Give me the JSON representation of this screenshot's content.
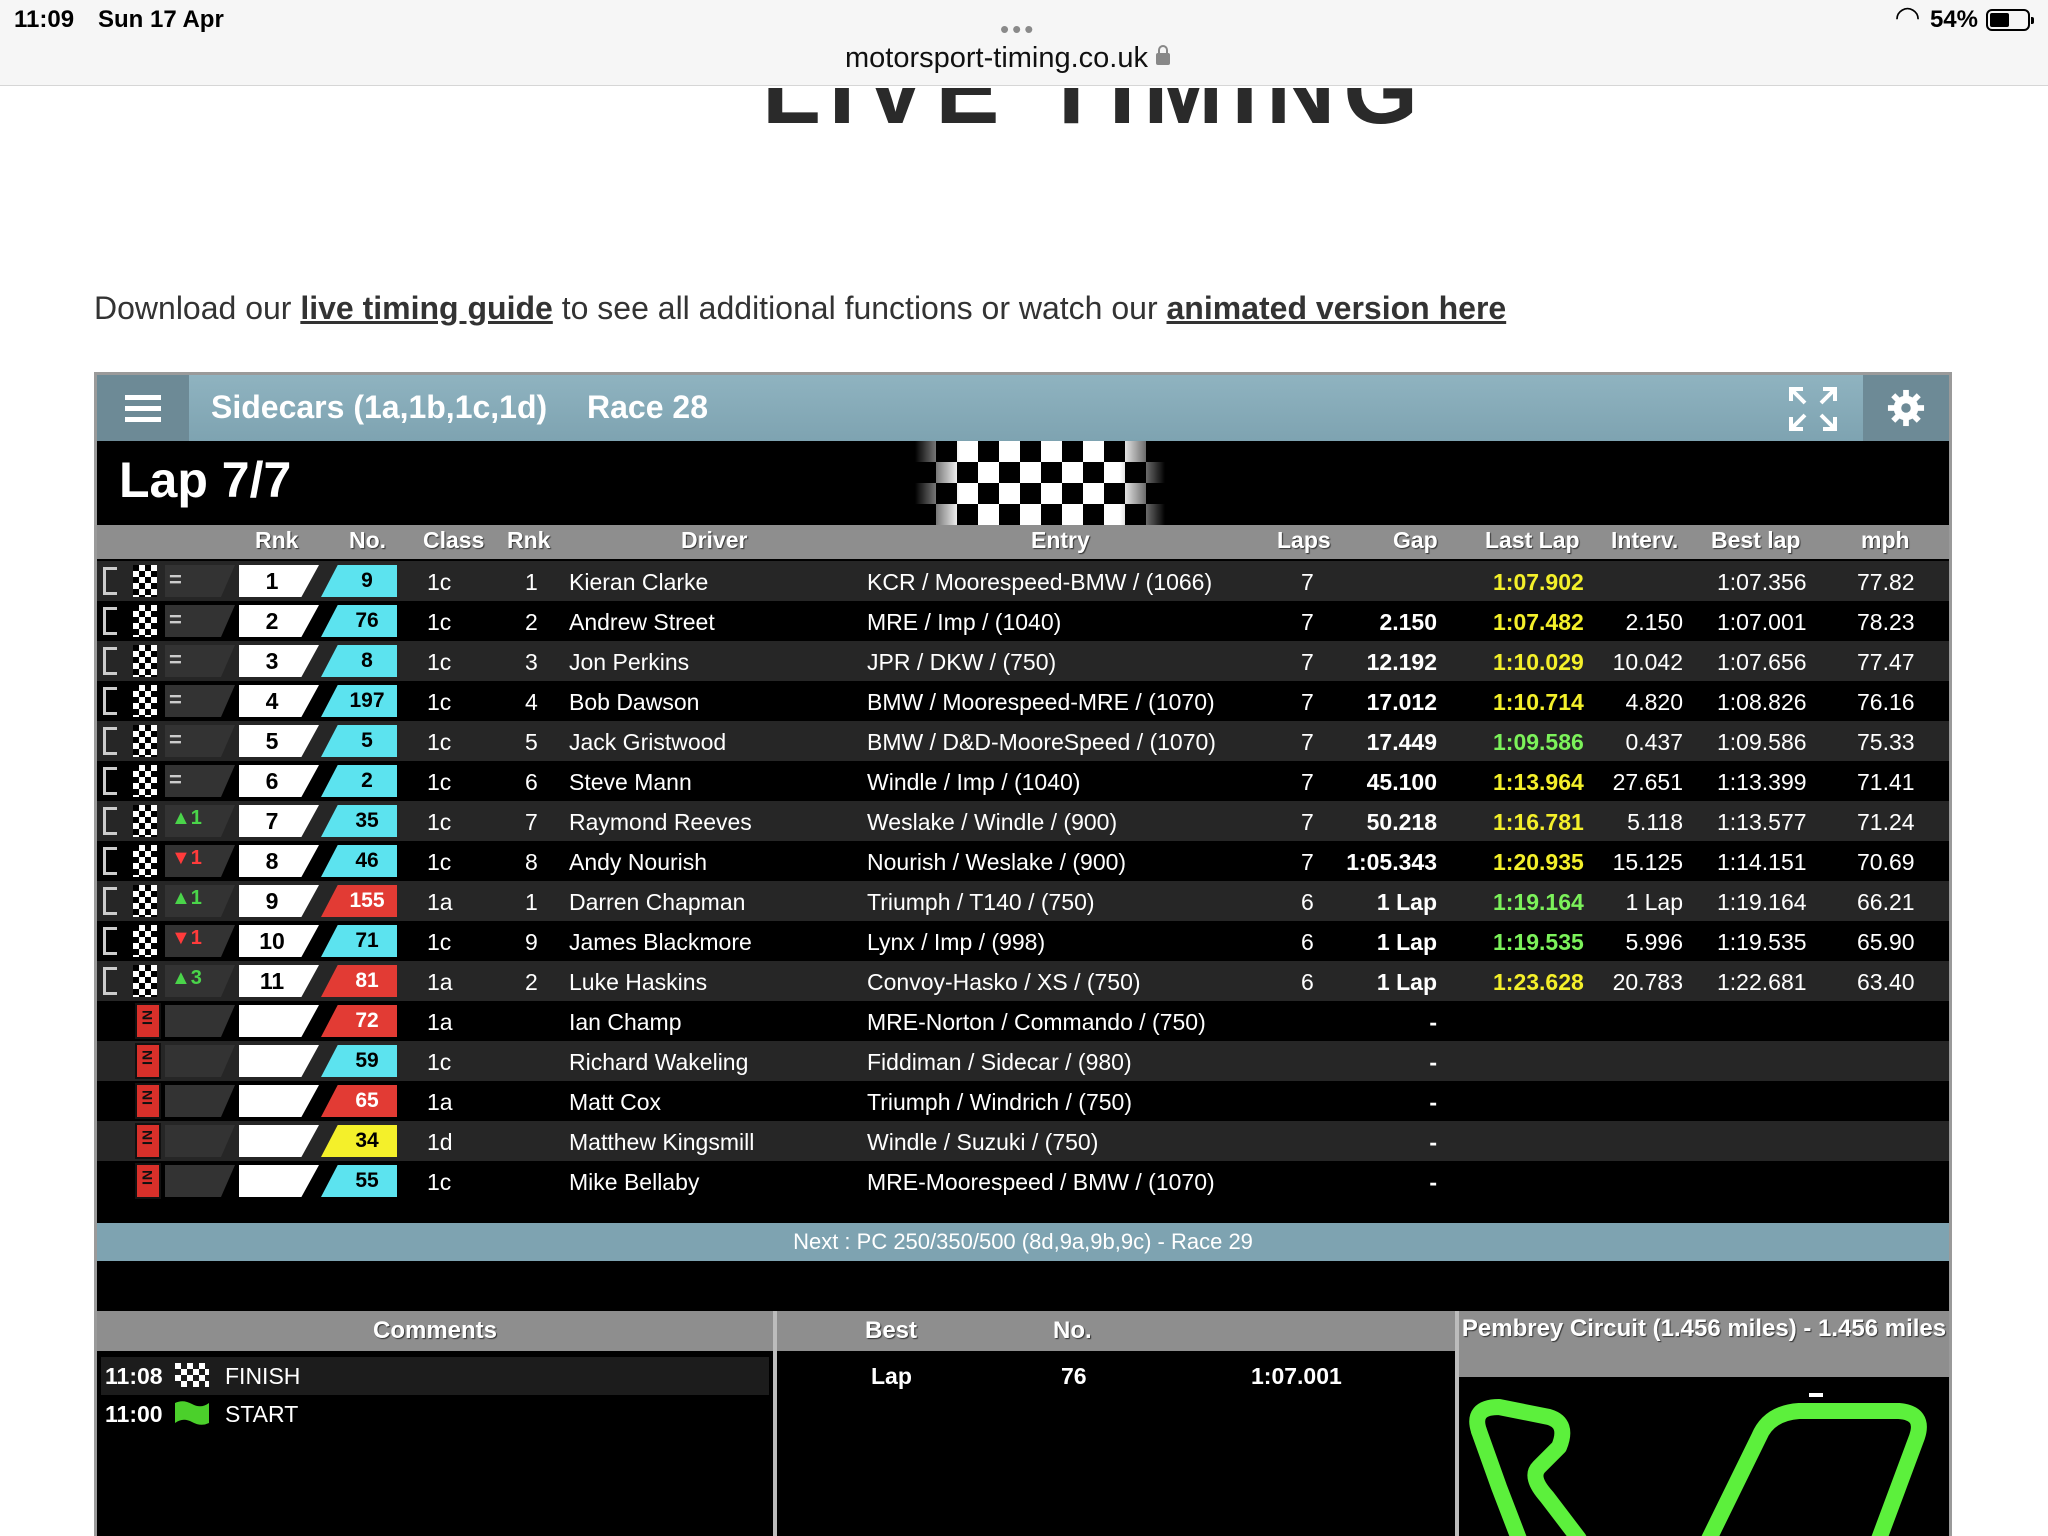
{
  "status_bar": {
    "time": "11:09",
    "date": "Sun 17 Apr",
    "battery": "54%",
    "battery_level": 0.54,
    "url": "motorsport-timing.co.uk"
  },
  "page": {
    "heading": "LIVE TIMING",
    "intro_prefix": "Download our",
    "intro_link1": "live timing guide",
    "intro_middle": "to see all additional functions or watch our",
    "intro_link2": "animated version here"
  },
  "widget": {
    "session": "Sidecars (1a,1b,1c,1d)",
    "race": "Race 28",
    "lap": "Lap 7/7",
    "columns": {
      "rnk": "Rnk",
      "no": "No.",
      "class": "Class",
      "class_rnk": "Rnk",
      "driver": "Driver",
      "entry": "Entry",
      "laps": "Laps",
      "gap": "Gap",
      "last_lap": "Last Lap",
      "interval": "Interv.",
      "best_lap": "Best lap",
      "mph": "mph"
    },
    "rows": [
      {
        "status": "=",
        "rank": "1",
        "no": "9",
        "no_color": "#5ce3ef",
        "class": "1c",
        "class_rank": "1",
        "driver": "Kieran Clarke",
        "entry": "KCR / Moorespeed-BMW / (1066)",
        "laps": "7",
        "gap": "",
        "last_lap": "1:07.902",
        "last_color": "yellow",
        "interval": "",
        "best_lap": "1:07.356",
        "mph": "77.82"
      },
      {
        "status": "=",
        "rank": "2",
        "no": "76",
        "no_color": "#5ce3ef",
        "class": "1c",
        "class_rank": "2",
        "driver": "Andrew Street",
        "entry": "MRE / Imp / (1040)",
        "laps": "7",
        "gap": "2.150",
        "last_lap": "1:07.482",
        "last_color": "yellow",
        "interval": "2.150",
        "best_lap": "1:07.001",
        "mph": "78.23"
      },
      {
        "status": "=",
        "rank": "3",
        "no": "8",
        "no_color": "#5ce3ef",
        "class": "1c",
        "class_rank": "3",
        "driver": "Jon Perkins",
        "entry": "JPR / DKW / (750)",
        "laps": "7",
        "gap": "12.192",
        "last_lap": "1:10.029",
        "last_color": "yellow",
        "interval": "10.042",
        "best_lap": "1:07.656",
        "mph": "77.47"
      },
      {
        "status": "=",
        "rank": "4",
        "no": "197",
        "no_color": "#5ce3ef",
        "class": "1c",
        "class_rank": "4",
        "driver": "Bob Dawson",
        "entry": "BMW / Mooresp­eed-MRE / (1070)",
        "laps": "7",
        "gap": "17.012",
        "last_lap": "1:10.714",
        "last_color": "yellow",
        "interval": "4.820",
        "best_lap": "1:08.826",
        "mph": "76.16"
      },
      {
        "status": "=",
        "rank": "5",
        "no": "5",
        "no_color": "#5ce3ef",
        "class": "1c",
        "class_rank": "5",
        "driver": "Jack Gristwood",
        "entry": "BMW / D&D-MooreSpeed / (1070)",
        "laps": "7",
        "gap": "17.449",
        "last_lap": "1:09.586",
        "last_color": "green",
        "interval": "0.437",
        "best_lap": "1:09.586",
        "mph": "75.33"
      },
      {
        "status": "=",
        "rank": "6",
        "no": "2",
        "no_color": "#5ce3ef",
        "class": "1c",
        "class_rank": "6",
        "driver": "Steve Mann",
        "entry": "Windle / Imp / (1040)",
        "laps": "7",
        "gap": "45.100",
        "last_lap": "1:13.964",
        "last_color": "yellow",
        "interval": "27.651",
        "best_lap": "1:13.399",
        "mph": "71.41"
      },
      {
        "status": "▲1",
        "rank": "7",
        "no": "35",
        "no_color": "#5ce3ef",
        "class": "1c",
        "class_rank": "7",
        "driver": "Raymond Reeves",
        "entry": "Weslake / Windle / (900)",
        "laps": "7",
        "gap": "50.218",
        "last_lap": "1:16.781",
        "last_color": "yellow",
        "interval": "5.118",
        "best_lap": "1:13.577",
        "mph": "71.24"
      },
      {
        "status": "▼1",
        "rank": "8",
        "no": "46",
        "no_color": "#5ce3ef",
        "class": "1c",
        "class_rank": "8",
        "driver": "Andy Nourish",
        "entry": "Nourish / Weslake / (900)",
        "laps": "7",
        "gap": "1:05.343",
        "last_lap": "1:20.935",
        "last_color": "yellow",
        "interval": "15.125",
        "best_lap": "1:14.151",
        "mph": "70.69"
      },
      {
        "status": "▲1",
        "rank": "9",
        "no": "155",
        "no_color": "#e23b34",
        "class": "1a",
        "class_rank": "1",
        "driver": "Darren Chapman",
        "entry": "Triumph / T140 / (750)",
        "laps": "6",
        "gap": "1 Lap",
        "last_lap": "1:19.164",
        "last_color": "green",
        "interval": "1 Lap",
        "best_lap": "1:19.164",
        "mph": "66.21"
      },
      {
        "status": "▼1",
        "rank": "10",
        "no": "71",
        "no_color": "#5ce3ef",
        "class": "1c",
        "class_rank": "9",
        "driver": "James Blackmore",
        "entry": "Lynx / Imp / (998)",
        "laps": "6",
        "gap": "1 Lap",
        "last_lap": "1:19.535",
        "last_color": "green",
        "interval": "5.996",
        "best_lap": "1:19.535",
        "mph": "65.90"
      },
      {
        "status": "▲3",
        "rank": "11",
        "no": "81",
        "no_color": "#e23b34",
        "class": "1a",
        "class_rank": "2",
        "driver": "Luke Haskins",
        "entry": "Convoy-Hasko / XS / (750)",
        "laps": "6",
        "gap": "1 Lap",
        "last_lap": "1:23.628",
        "last_color": "yellow",
        "interval": "20.783",
        "best_lap": "1:22.681",
        "mph": "63.40"
      },
      {
        "status": "IN",
        "rank": "",
        "no": "72",
        "no_color": "#e23b34",
        "class": "1a",
        "class_rank": "",
        "driver": "Ian Champ",
        "entry": "MRE-Norton / Commando / (750)",
        "laps": "",
        "gap": "-",
        "last_lap": "",
        "last_color": "",
        "interval": "",
        "best_lap": "",
        "mph": ""
      },
      {
        "status": "IN",
        "rank": "",
        "no": "59",
        "no_color": "#5ce3ef",
        "class": "1c",
        "class_rank": "",
        "driver": "Richard Wakeling",
        "entry": "Fiddiman / Sidecar / (980)",
        "laps": "",
        "gap": "-",
        "last_lap": "",
        "last_color": "",
        "interval": "",
        "best_lap": "",
        "mph": ""
      },
      {
        "status": "IN",
        "rank": "",
        "no": "65",
        "no_color": "#e23b34",
        "class": "1a",
        "class_rank": "",
        "driver": "Matt Cox",
        "entry": "Triumph / Windrich / (750)",
        "laps": "",
        "gap": "-",
        "last_lap": "",
        "last_color": "",
        "interval": "",
        "best_lap": "",
        "mph": ""
      },
      {
        "status": "IN",
        "rank": "",
        "no": "34",
        "no_color": "#f4f02a",
        "class": "1d",
        "class_rank": "",
        "driver": "Matthew Kingsmill",
        "entry": "Windle / Suzuki / (750)",
        "laps": "",
        "gap": "-",
        "last_lap": "",
        "last_color": "",
        "interval": "",
        "best_lap": "",
        "mph": ""
      },
      {
        "status": "IN",
        "rank": "",
        "no": "55",
        "no_color": "#5ce3ef",
        "class": "1c",
        "class_rank": "",
        "driver": "Mike Bellaby",
        "entry": "MRE-Moorespeed / BMW / (1070)",
        "laps": "",
        "gap": "-",
        "last_lap": "",
        "last_color": "",
        "interval": "",
        "best_lap": "",
        "mph": ""
      }
    ],
    "next": "Next : PC 250/350/500 (8d,9a,9b,9c) - Race 29",
    "comments": {
      "title": "Comments",
      "items": [
        {
          "time": "11:08",
          "flag": "chequered-flag",
          "text": "FINISH"
        },
        {
          "time": "11:00",
          "flag": "green-flag",
          "text": "START"
        }
      ]
    },
    "best": {
      "header_best": "Best",
      "header_no": "No.",
      "label": "Lap",
      "no": "76",
      "time": "1:07.001"
    },
    "circuit": {
      "title": "Pembrey Circuit (1.456 miles) - 1.456 miles",
      "track_color": "#5cf03c"
    }
  }
}
